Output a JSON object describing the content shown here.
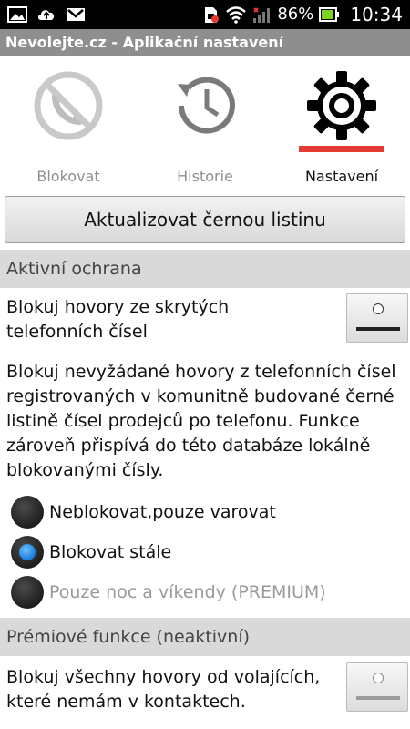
{
  "status_bar": {
    "icons_left": [
      "image-icon",
      "cloud-upload-icon",
      "gmail-icon"
    ],
    "icons_right": [
      "sim-error-icon",
      "wifi-icon",
      "signal-icon"
    ],
    "battery_percent": "86%",
    "time": "10:34"
  },
  "app": {
    "title": "Nevolejte.cz - Aplikační nastavení"
  },
  "tabs": [
    {
      "label": "Blokovat",
      "icon": "blocked-phone-icon",
      "active": false
    },
    {
      "label": "Historie",
      "icon": "history-clock-icon",
      "active": false
    },
    {
      "label": "Nastavení",
      "icon": "gear-icon",
      "active": true
    }
  ],
  "update_button": {
    "label": "Aktualizovat černou listinu"
  },
  "section_active": {
    "header": "Aktivní ochrana",
    "hidden_numbers": {
      "line1": "Blokuj hovory ze skrytých",
      "line2": "telefonních čísel",
      "toggle_on": false
    },
    "description": "Blokuj nevyžádané hovory z telefonních čísel registrovaných v komunitně budované černé listině čísel prodejců po telefonu. Funkce zároveň přispívá do této databáze lokálně blokovanými čísly.",
    "options": [
      {
        "label": "Neblokovat,pouze varovat",
        "selected": false,
        "enabled": true
      },
      {
        "label": "Blokovat stále",
        "selected": true,
        "enabled": true
      },
      {
        "label": "Pouze noc a víkendy (PREMIUM)",
        "selected": false,
        "enabled": false
      }
    ]
  },
  "section_premium": {
    "header": "Prémiové funkce (neaktivní)",
    "block_unknown": {
      "line1": "Blokuj všechny hovory od volajících,",
      "line2": "které nemám v kontaktech."
    }
  },
  "colors": {
    "status_bar_bg": "#000000",
    "title_bar_bg": "#8e8e8e",
    "tab_indicator": "#e53935",
    "section_bg": "#d9d9d9",
    "radio_selected": "#1a7ad8"
  }
}
